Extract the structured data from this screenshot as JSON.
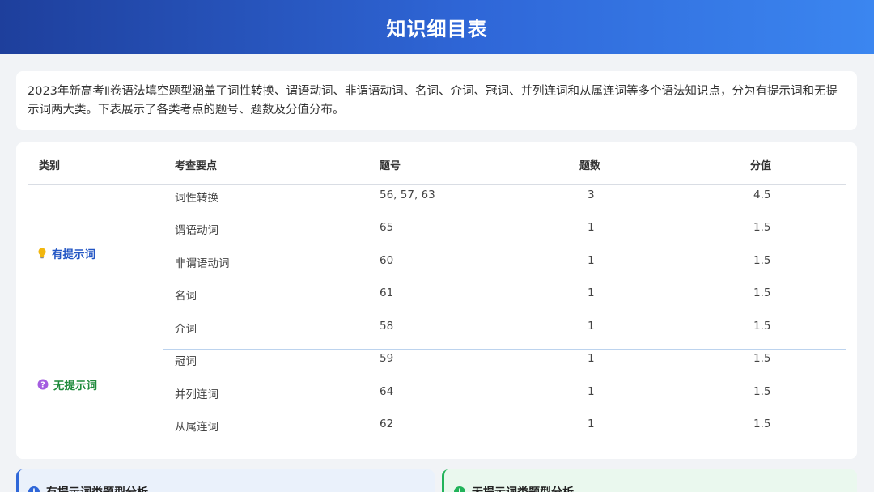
{
  "header": {
    "title": "知识细目表"
  },
  "intro": {
    "text": "2023年新高考Ⅱ卷语法填空题型涵盖了词性转换、谓语动词、非谓语动词、名词、介词、冠词、并列连词和从属连词等多个语法知识点，分为有提示词和无提示词两大类。下表展示了各类考点的题号、题数及分值分布。"
  },
  "table": {
    "headers": [
      "类别",
      "考查要点",
      "题号",
      "题数",
      "分值"
    ],
    "categories": [
      {
        "label": "有提示词",
        "icon": "lightbulb-icon",
        "color": "#2255c4"
      },
      {
        "label": "无提示词",
        "icon": "question-icon",
        "color": "#1f8a3c"
      }
    ],
    "rows": [
      {
        "point": "词性转换",
        "num": "56, 57, 63",
        "count": "3",
        "score": "4.5"
      },
      {
        "point": "谓语动词",
        "num": "65",
        "count": "1",
        "score": "1.5"
      },
      {
        "point": "非谓语动词",
        "num": "60",
        "count": "1",
        "score": "1.5"
      },
      {
        "point": "名词",
        "num": "61",
        "count": "1",
        "score": "1.5"
      },
      {
        "point": "介词",
        "num": "58",
        "count": "1",
        "score": "1.5"
      },
      {
        "point": "冠词",
        "num": "59",
        "count": "1",
        "score": "1.5"
      },
      {
        "point": "并列连词",
        "num": "64",
        "count": "1",
        "score": "1.5"
      },
      {
        "point": "从属连词",
        "num": "62",
        "count": "1",
        "score": "1.5"
      }
    ]
  },
  "cards": [
    {
      "title": "有提示词类题型分析",
      "icon": "info-icon",
      "accent": "#2f67d8"
    },
    {
      "title": "无提示词类题型分析",
      "icon": "info-icon",
      "accent": "#22b35a"
    }
  ]
}
